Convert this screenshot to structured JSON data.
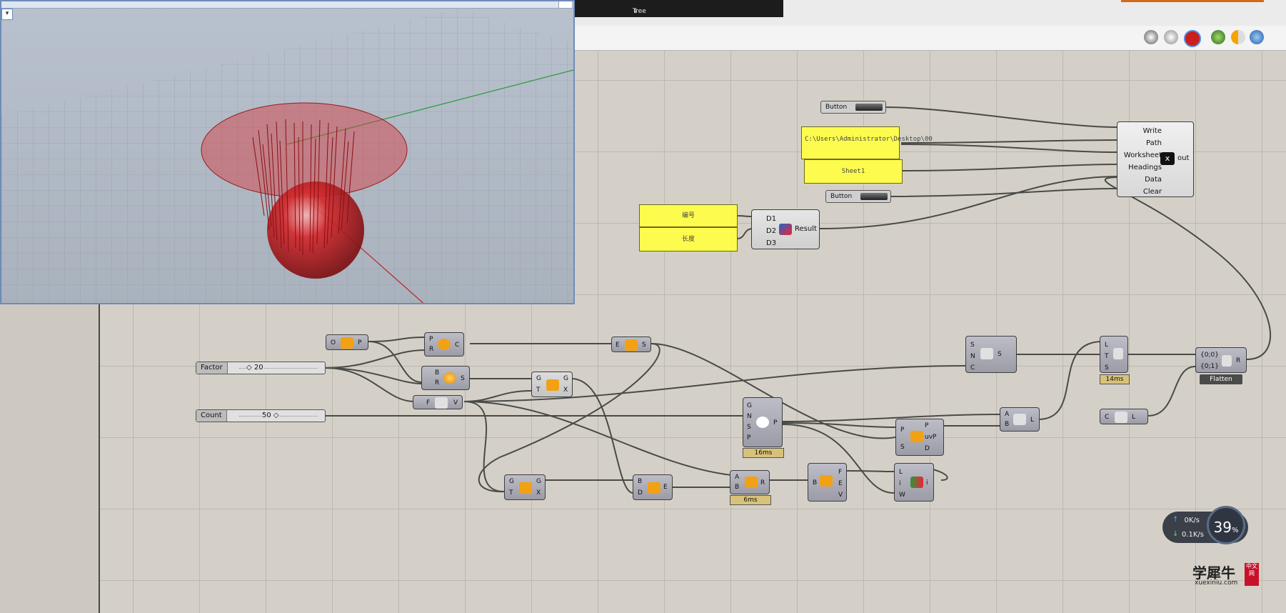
{
  "toolbar": {
    "tab_label": "Tree",
    "tab_scroll": "↓"
  },
  "viewport": {
    "corner_label": "▾"
  },
  "buttons": {
    "button1": "Button",
    "button2": "Button"
  },
  "panels": {
    "path_text": "C:\\Users\\Administrator\\Desktop\\00",
    "sheet_text": "Sheet1",
    "header1": "编号",
    "header2": "长度"
  },
  "sliders": {
    "factor_label": "Factor",
    "factor_value": "◇ 20",
    "count_label": "Count",
    "count_value": "50 ◇"
  },
  "excel_writer": {
    "inputs": [
      "Write",
      "Path",
      "Worksheet",
      "Headings",
      "Data",
      "Clear"
    ],
    "output": "out"
  },
  "merge": {
    "inputs": [
      "D1",
      "D2",
      "D3"
    ],
    "output": "Result"
  },
  "components": {
    "plane": {
      "in": [
        "O"
      ],
      "out": "P"
    },
    "circle": {
      "in": [
        "P",
        "R"
      ],
      "out": "C"
    },
    "sphere": {
      "in": [
        "B",
        "R"
      ],
      "out": "S"
    },
    "zvec": {
      "in": [
        "F"
      ],
      "out": "V"
    },
    "ext": {
      "in": [
        "E"
      ],
      "out": "S"
    },
    "move1": {
      "in": [
        "G",
        "T"
      ],
      "out": [
        "G",
        "X"
      ]
    },
    "move2": {
      "in": [
        "G",
        "T"
      ],
      "out": [
        "G",
        "X"
      ]
    },
    "populate": {
      "in": [
        "G",
        "N",
        "S",
        "P"
      ],
      "out": "P"
    },
    "ptc": {
      "in": [
        "P",
        "S"
      ],
      "out": [
        "P",
        "uvP",
        "D"
      ]
    },
    "line": {
      "in": [
        "A",
        "B"
      ],
      "out": "L"
    },
    "series": {
      "in": [
        "S",
        "N",
        "C"
      ],
      "out": "S"
    },
    "divide": {
      "in": [
        "L",
        "T",
        "S"
      ],
      "out": []
    },
    "length": {
      "in": [
        "C"
      ],
      "out": "L"
    },
    "entwine": {
      "in": [
        "{0;0}",
        "{0;1}"
      ],
      "out": "R"
    },
    "projection": {
      "in": [
        "B",
        "D"
      ],
      "out": "E"
    },
    "bbox": {
      "in": [
        "A",
        "B"
      ],
      "out": "R"
    },
    "deconstruct": {
      "in": [
        "B"
      ],
      "out": [
        "F",
        "E",
        "V"
      ]
    },
    "insert": {
      "in": [
        "L",
        "i",
        "W"
      ],
      "out": "i"
    }
  },
  "timings": {
    "populate": "16ms",
    "divide": "14ms",
    "bbox": "6ms"
  },
  "flatten_label": "Flatten",
  "network": {
    "up": "0K/s",
    "down": "0.1K/s",
    "percent": "39",
    "percent_unit": "%"
  },
  "watermark": {
    "text": "学犀牛",
    "url": "xuexiniu.com",
    "badge": "中文网"
  }
}
